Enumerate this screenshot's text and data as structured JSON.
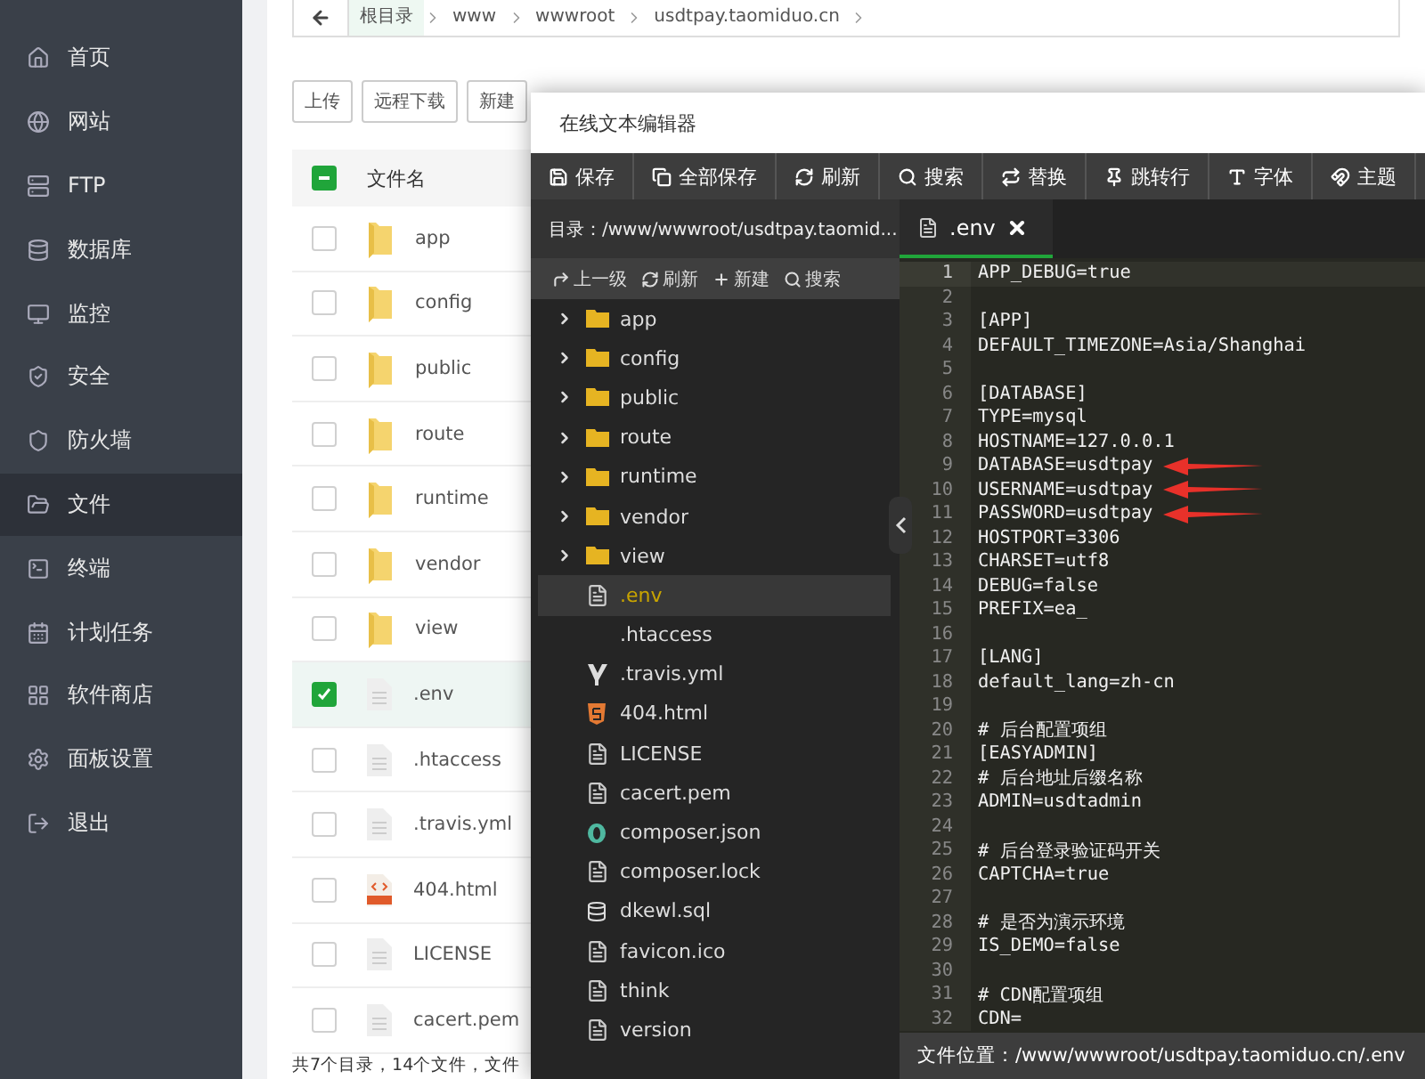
{
  "sidebar": {
    "items": [
      {
        "label": "首页",
        "selected": false
      },
      {
        "label": "网站",
        "selected": false
      },
      {
        "label": "FTP",
        "selected": false
      },
      {
        "label": "数据库",
        "selected": false
      },
      {
        "label": "监控",
        "selected": false
      },
      {
        "label": "安全",
        "selected": false
      },
      {
        "label": "防火墙",
        "selected": false
      },
      {
        "label": "文件",
        "selected": true
      },
      {
        "label": "终端",
        "selected": false
      },
      {
        "label": "计划任务",
        "selected": false
      },
      {
        "label": "软件商店",
        "selected": false
      },
      {
        "label": "面板设置",
        "selected": false
      },
      {
        "label": "退出",
        "selected": false
      }
    ]
  },
  "breadcrumb": [
    "根目录",
    "www",
    "wwwroot",
    "usdtpay.taomiduo.cn"
  ],
  "actions": [
    {
      "label": "上传",
      "caret": false
    },
    {
      "label": "远程下载",
      "caret": false
    },
    {
      "label": "新建",
      "caret": false
    }
  ],
  "files": {
    "column": "文件名",
    "select_all_partial": true,
    "rows": [
      {
        "name": "app",
        "kind": "folder",
        "checked": false
      },
      {
        "name": "config",
        "kind": "folder",
        "checked": false
      },
      {
        "name": "public",
        "kind": "folder",
        "checked": false
      },
      {
        "name": "route",
        "kind": "folder",
        "checked": false
      },
      {
        "name": "runtime",
        "kind": "folder",
        "checked": false
      },
      {
        "name": "vendor",
        "kind": "folder",
        "checked": false
      },
      {
        "name": "view",
        "kind": "folder",
        "checked": false
      },
      {
        "name": ".env",
        "kind": "file",
        "checked": true
      },
      {
        "name": ".htaccess",
        "kind": "file",
        "checked": false
      },
      {
        "name": ".travis.yml",
        "kind": "file",
        "checked": false
      },
      {
        "name": "404.html",
        "kind": "html",
        "checked": false
      },
      {
        "name": "LICENSE",
        "kind": "file",
        "checked": false
      },
      {
        "name": "cacert.pem",
        "kind": "file",
        "checked": false
      }
    ],
    "summary": "共7个目录，14个文件，文件"
  },
  "editor": {
    "title": "在线文本编辑器",
    "toolbar": [
      "保存",
      "全部保存",
      "刷新",
      "搜索",
      "替换",
      "跳转行",
      "字体",
      "主题"
    ],
    "directory": "目录：/www/wwwroot/usdtpay.taomid...",
    "tabs": [
      {
        "label": ".env",
        "selected": true
      }
    ],
    "tree_tools": [
      "上一级",
      "刷新",
      "新建",
      "搜索"
    ],
    "tree": [
      {
        "name": "app",
        "kind": "folder",
        "selected": false
      },
      {
        "name": "config",
        "kind": "folder",
        "selected": false
      },
      {
        "name": "public",
        "kind": "folder",
        "selected": false
      },
      {
        "name": "route",
        "kind": "folder",
        "selected": false
      },
      {
        "name": "runtime",
        "kind": "folder",
        "selected": false
      },
      {
        "name": "vendor",
        "kind": "folder",
        "selected": false
      },
      {
        "name": "view",
        "kind": "folder",
        "selected": false
      },
      {
        "name": ".env",
        "kind": "file",
        "selected": true
      },
      {
        "name": ".htaccess",
        "kind": "plain",
        "selected": false
      },
      {
        "name": ".travis.yml",
        "kind": "yaml",
        "selected": false
      },
      {
        "name": "404.html",
        "kind": "html",
        "selected": false
      },
      {
        "name": "LICENSE",
        "kind": "file",
        "selected": false
      },
      {
        "name": "cacert.pem",
        "kind": "file",
        "selected": false
      },
      {
        "name": "composer.json",
        "kind": "json",
        "selected": false
      },
      {
        "name": "composer.lock",
        "kind": "file",
        "selected": false
      },
      {
        "name": "dkewl.sql",
        "kind": "db",
        "selected": false
      },
      {
        "name": "favicon.ico",
        "kind": "file",
        "selected": false
      },
      {
        "name": "think",
        "kind": "file",
        "selected": false
      },
      {
        "name": "version",
        "kind": "file",
        "selected": false
      }
    ],
    "lines": [
      {
        "number": "1",
        "text": "APP_DEBUG=true",
        "current": true,
        "marked": false
      },
      {
        "number": "2",
        "current": false,
        "marked": false
      },
      {
        "number": "3",
        "text": "[APP]",
        "current": false,
        "marked": false
      },
      {
        "number": "4",
        "text": "DEFAULT_TIMEZONE=Asia/Shanghai",
        "current": false,
        "marked": false
      },
      {
        "number": "5",
        "current": false,
        "marked": false
      },
      {
        "number": "6",
        "text": "[DATABASE]",
        "current": false,
        "marked": false
      },
      {
        "number": "7",
        "text": "TYPE=mysql",
        "current": false,
        "marked": false
      },
      {
        "number": "8",
        "text": "HOSTNAME=127.0.0.1",
        "current": false,
        "marked": false
      },
      {
        "number": "9",
        "text": "DATABASE=usdtpay",
        "current": false,
        "marked": true
      },
      {
        "number": "10",
        "text": "USERNAME=usdtpay",
        "current": false,
        "marked": true
      },
      {
        "number": "11",
        "text": "PASSWORD=usdtpay",
        "current": false,
        "marked": true
      },
      {
        "number": "12",
        "text": "HOSTPORT=3306",
        "current": false,
        "marked": false
      },
      {
        "number": "13",
        "text": "CHARSET=utf8",
        "current": false,
        "marked": false
      },
      {
        "number": "14",
        "text": "DEBUG=false",
        "current": false,
        "marked": false
      },
      {
        "number": "15",
        "text": "PREFIX=ea_",
        "current": false,
        "marked": false
      },
      {
        "number": "16",
        "current": false,
        "marked": false
      },
      {
        "number": "17",
        "text": "[LANG]",
        "current": false,
        "marked": false
      },
      {
        "number": "18",
        "text": "default_lang=zh-cn",
        "current": false,
        "marked": false
      },
      {
        "number": "19",
        "current": false,
        "marked": false
      },
      {
        "number": "20",
        "text": "# 后台配置项组",
        "current": false,
        "marked": false
      },
      {
        "number": "21",
        "text": "[EASYADMIN]",
        "current": false,
        "marked": false
      },
      {
        "number": "22",
        "text": "# 后台地址后缀名称",
        "current": false,
        "marked": false
      },
      {
        "number": "23",
        "text": "ADMIN=usdtadmin",
        "current": false,
        "marked": false
      },
      {
        "number": "24",
        "current": false,
        "marked": false
      },
      {
        "number": "25",
        "text": "# 后台登录验证码开关",
        "current": false,
        "marked": false
      },
      {
        "number": "26",
        "text": "CAPTCHA=true",
        "current": false,
        "marked": false
      },
      {
        "number": "27",
        "current": false,
        "marked": false
      },
      {
        "number": "28",
        "text": "# 是否为演示环境",
        "current": false,
        "marked": false
      },
      {
        "number": "29",
        "text": "IS_DEMO=false",
        "current": false,
        "marked": false
      },
      {
        "number": "30",
        "current": false,
        "marked": false
      },
      {
        "number": "31",
        "text": "# CDN配置项组",
        "current": false,
        "marked": false
      },
      {
        "number": "32",
        "text": "CDN=",
        "current": false,
        "marked": false
      }
    ],
    "status": "文件位置：/www/wwwroot/usdtpay.taomiduo.cn/.env"
  }
}
